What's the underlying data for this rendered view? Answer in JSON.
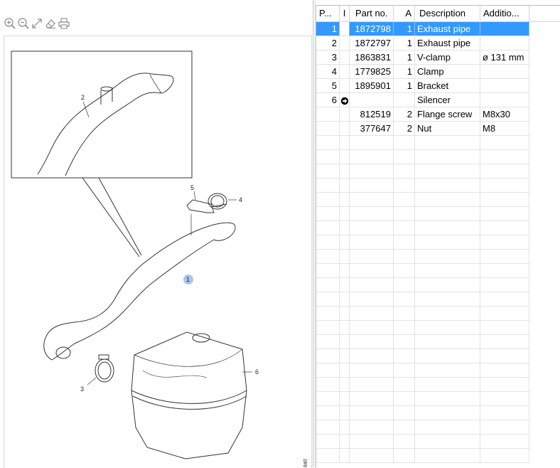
{
  "toolbar": {
    "tools": [
      {
        "name": "zoom-in-icon"
      },
      {
        "name": "zoom-out-icon"
      },
      {
        "name": "fit-to-window-icon"
      },
      {
        "name": "eraser-icon"
      },
      {
        "name": "print-icon"
      }
    ]
  },
  "diagram": {
    "callouts": [
      "1",
      "2",
      "3",
      "4",
      "5",
      "6"
    ],
    "side_code": "840",
    "highlight_color": "#a9c4ee"
  },
  "grid": {
    "headers": [
      "P...",
      "I",
      "Part no.",
      "A",
      "Description",
      "Additio..."
    ],
    "rows": [
      {
        "pos": "1",
        "flag": "",
        "part": "1872798",
        "qty": "1",
        "desc": "Exhaust pipe",
        "add": "",
        "selected": true
      },
      {
        "pos": "2",
        "flag": "",
        "part": "1872797",
        "qty": "1",
        "desc": "Exhaust pipe",
        "add": ""
      },
      {
        "pos": "3",
        "flag": "",
        "part": "1863831",
        "qty": "1",
        "desc": "V-clamp",
        "add": "ø 131 mm"
      },
      {
        "pos": "4",
        "flag": "",
        "part": "1779825",
        "qty": "1",
        "desc": "Clamp",
        "add": ""
      },
      {
        "pos": "5",
        "flag": "",
        "part": "1895901",
        "qty": "1",
        "desc": "Bracket",
        "add": ""
      },
      {
        "pos": "6",
        "flag": "arrow-right-icon",
        "part": "",
        "qty": "",
        "desc": "Silencer",
        "add": ""
      },
      {
        "pos": "",
        "flag": "",
        "part": "812519",
        "qty": "2",
        "desc": "Flange screw",
        "add": "M8x30"
      },
      {
        "pos": "",
        "flag": "",
        "part": "377647",
        "qty": "2",
        "desc": "Nut",
        "add": "M8"
      }
    ],
    "empty_rows": 23,
    "selection_color": "#3399ff"
  }
}
